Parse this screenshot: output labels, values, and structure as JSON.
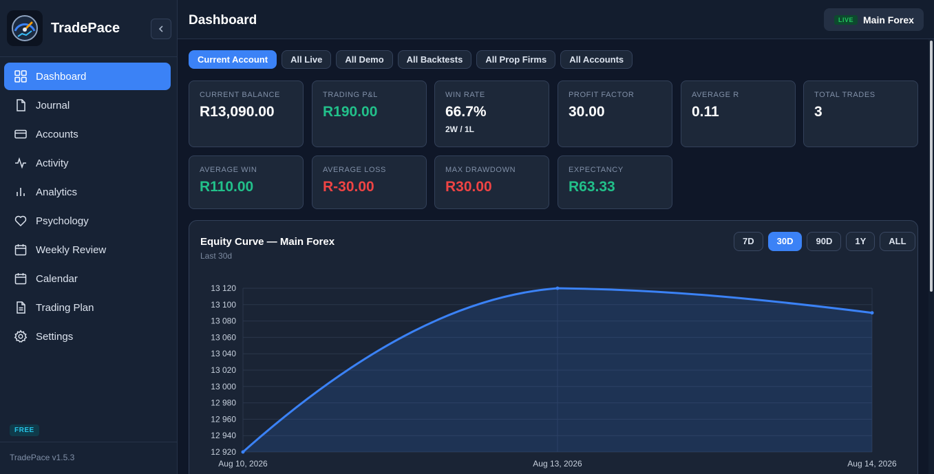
{
  "app": {
    "name": "TradePace",
    "version": "TradePace v1.5.3",
    "plan": "FREE"
  },
  "sidebar": {
    "items": [
      {
        "label": "Dashboard",
        "icon": "dashboard-grid-icon"
      },
      {
        "label": "Journal",
        "icon": "file-icon"
      },
      {
        "label": "Accounts",
        "icon": "credit-card-icon"
      },
      {
        "label": "Activity",
        "icon": "activity-icon"
      },
      {
        "label": "Analytics",
        "icon": "bar-chart-icon"
      },
      {
        "label": "Psychology",
        "icon": "heart-icon"
      },
      {
        "label": "Weekly Review",
        "icon": "calendar-icon"
      },
      {
        "label": "Calendar",
        "icon": "calendar-icon"
      },
      {
        "label": "Trading Plan",
        "icon": "document-text-icon"
      },
      {
        "label": "Settings",
        "icon": "gear-icon"
      }
    ],
    "active": "Dashboard"
  },
  "header": {
    "title": "Dashboard",
    "account_status": "LIVE",
    "account_name": "Main Forex"
  },
  "filters": {
    "items": [
      "Current Account",
      "All Live",
      "All Demo",
      "All Backtests",
      "All Prop Firms",
      "All Accounts"
    ],
    "active": "Current Account"
  },
  "stats": [
    {
      "label": "CURRENT BALANCE",
      "value": "R13,090.00",
      "tone": "neutral"
    },
    {
      "label": "TRADING P&L",
      "value": "R190.00",
      "tone": "positive"
    },
    {
      "label": "WIN RATE",
      "value": "66.7%",
      "sub": "2W / 1L",
      "tone": "neutral"
    },
    {
      "label": "PROFIT FACTOR",
      "value": "30.00",
      "tone": "neutral"
    },
    {
      "label": "AVERAGE R",
      "value": "0.11",
      "tone": "neutral"
    },
    {
      "label": "TOTAL TRADES",
      "value": "3",
      "tone": "neutral"
    },
    {
      "label": "AVERAGE WIN",
      "value": "R110.00",
      "tone": "positive"
    },
    {
      "label": "AVERAGE LOSS",
      "value": "R-30.00",
      "tone": "negative"
    },
    {
      "label": "MAX DRAWDOWN",
      "value": "R30.00",
      "tone": "negative"
    },
    {
      "label": "EXPECTANCY",
      "value": "R63.33",
      "tone": "positive"
    }
  ],
  "equity": {
    "title": "Equity Curve — Main Forex",
    "subtitle": "Last 30d",
    "ranges": [
      "7D",
      "30D",
      "90D",
      "1Y",
      "ALL"
    ],
    "active_range": "30D"
  },
  "colors": {
    "accent": "#3b82f6",
    "positive": "#22c08a",
    "negative": "#ef4444"
  },
  "chart_data": {
    "type": "area",
    "x": [
      "Aug 10, 2026",
      "Aug 13, 2026",
      "Aug 14, 2026"
    ],
    "values": [
      12920,
      13120,
      13090
    ],
    "ylim": [
      12920,
      13120
    ],
    "yticks": [
      "12 920",
      "12 940",
      "12 960",
      "12 980",
      "13 000",
      "13 020",
      "13 040",
      "13 060",
      "13 080",
      "13 100",
      "13 120"
    ],
    "ytick_values": [
      12920,
      12940,
      12960,
      12980,
      13000,
      13020,
      13040,
      13060,
      13080,
      13100,
      13120
    ],
    "grid": true
  }
}
